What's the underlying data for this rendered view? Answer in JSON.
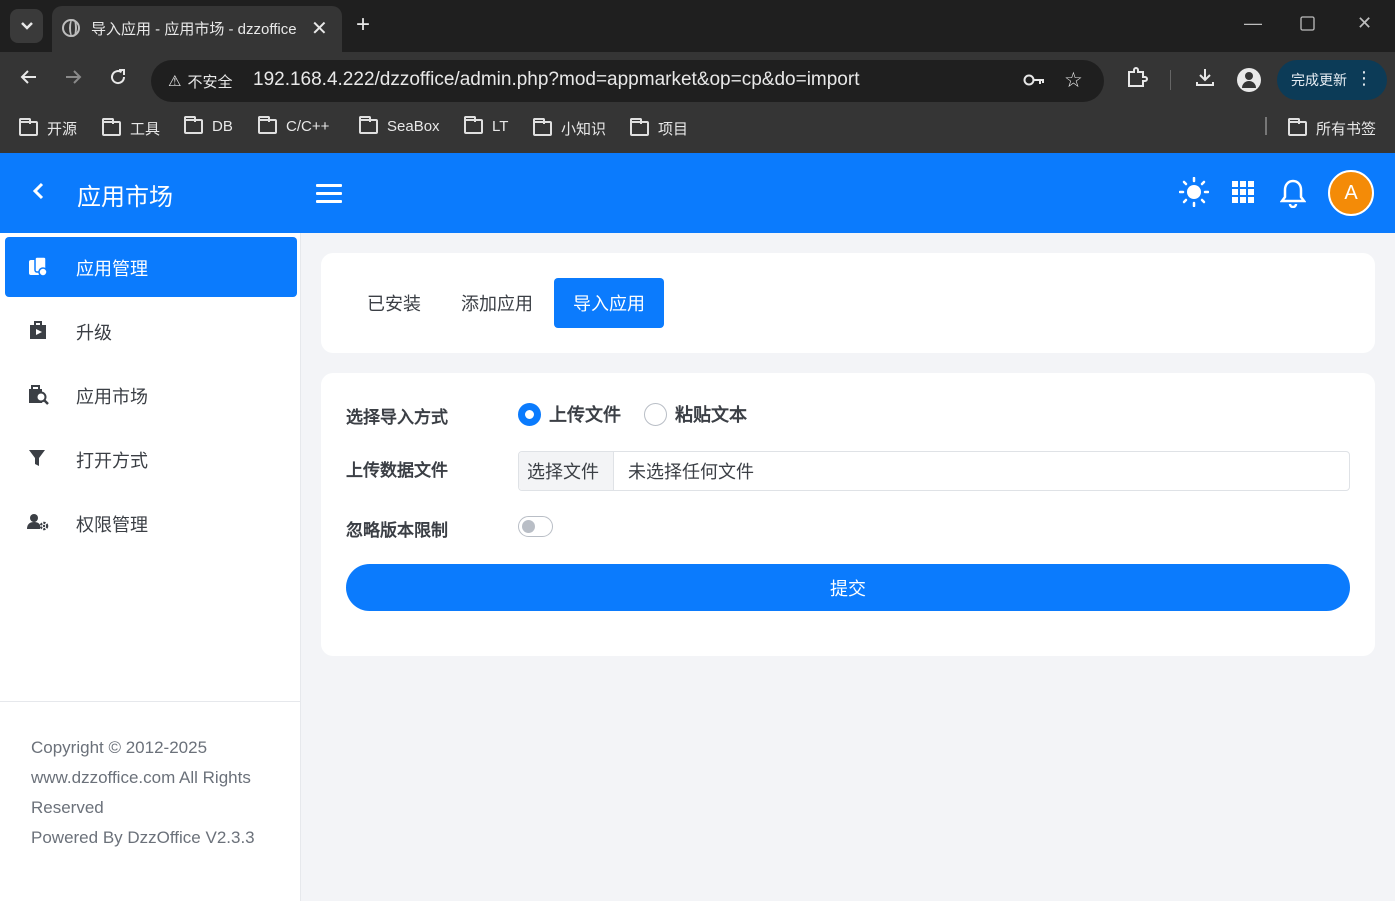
{
  "browser": {
    "tab_title": "导入应用 - 应用市场 - dzzoffice",
    "security_label": "不安全",
    "url": "192.168.4.222/dzzoffice/admin.php?mod=appmarket&op=cp&do=import",
    "update_label": "完成更新",
    "bookmarks": [
      "开源",
      "工具",
      "DB",
      "C/C++",
      "SeaBox",
      "LT",
      "小知识",
      "项目"
    ],
    "all_bookmarks": "所有书签"
  },
  "header": {
    "title": "应用市场",
    "avatar_letter": "A",
    "accent_color": "#0b7bfd"
  },
  "sidebar": {
    "items": [
      {
        "label": "应用管理",
        "icon": "app-manage-icon",
        "active": true
      },
      {
        "label": "升级",
        "icon": "upgrade-icon",
        "active": false
      },
      {
        "label": "应用市场",
        "icon": "market-icon",
        "active": false
      },
      {
        "label": "打开方式",
        "icon": "filter-icon",
        "active": false
      },
      {
        "label": "权限管理",
        "icon": "user-gear-icon",
        "active": false
      }
    ],
    "footer": {
      "line1": "Copyright © 2012-2025",
      "line2": "www.dzzoffice.com All Rights",
      "line3": "Reserved",
      "line4": "Powered By DzzOffice V2.3.3"
    }
  },
  "tabs": [
    {
      "label": "已安装",
      "active": false
    },
    {
      "label": "添加应用",
      "active": false
    },
    {
      "label": "导入应用",
      "active": true
    }
  ],
  "form": {
    "import_mode_label": "选择导入方式",
    "mode_upload": "上传文件",
    "mode_paste": "粘贴文本",
    "upload_label": "上传数据文件",
    "choose_file": "选择文件",
    "no_file": "未选择任何文件",
    "ignore_version_label": "忽略版本限制",
    "submit": "提交"
  }
}
